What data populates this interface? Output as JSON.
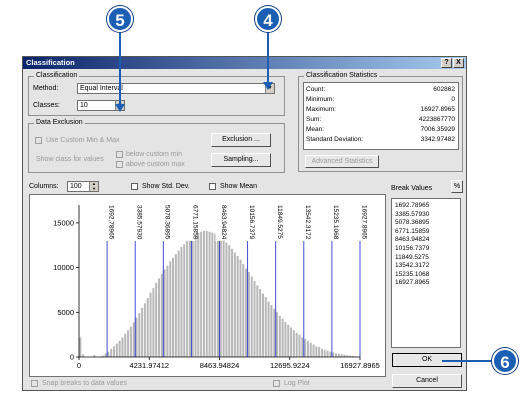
{
  "window": {
    "title": "Classification",
    "help_btn": "?",
    "close_btn": "X"
  },
  "classification": {
    "group_label": "Classification",
    "method_label": "Method:",
    "method_value": "Equal Interval",
    "classes_label": "Classes:",
    "classes_value": "10"
  },
  "data_exclusion": {
    "group_label": "Data Exclusion",
    "use_custom_label": "Use Custom Min & Max",
    "show_class_label": "Show class for values",
    "below_label": "below custom min",
    "above_label": "above custom max",
    "exclusion_btn": "Exclusion ...",
    "sampling_btn": "Sampling..."
  },
  "statistics": {
    "group_label": "Classification Statistics",
    "rows": [
      {
        "key": "Count:",
        "value": "602862"
      },
      {
        "key": "Minimum:",
        "value": "0"
      },
      {
        "key": "Maximum:",
        "value": "16927.8965"
      },
      {
        "key": "Sum:",
        "value": "4223867770"
      },
      {
        "key": "Mean:",
        "value": "7006.35929"
      },
      {
        "key": "Standard Deviation:",
        "value": "3342.97482"
      }
    ],
    "advanced_btn": "Advanced Statistics"
  },
  "controls": {
    "columns_label": "Columns:",
    "columns_value": "100",
    "show_std_dev": "Show Std. Dev.",
    "show_mean": "Show Mean"
  },
  "break_values": {
    "label": "Break Values",
    "percent_btn": "%",
    "values": [
      "1692.78965",
      "3385.57930",
      "5078.36895",
      "6771.15859",
      "8463.94824",
      "10156.7379",
      "11849.5275",
      "13542.3172",
      "15235.1068",
      "16927.8965"
    ]
  },
  "buttons": {
    "ok": "OK",
    "cancel": "Cancel"
  },
  "footer": {
    "snap_label": "Snap breaks to data values",
    "log_label": "Log Plot"
  },
  "callouts": {
    "c5": "5",
    "c4": "4",
    "c6": "6"
  },
  "colors": {
    "break_line": "#2b3bd6",
    "histogram_bar": "#b8b8b8",
    "callout": "#1a5fb4"
  },
  "chart_data": {
    "type": "bar",
    "title": "",
    "xlabel": "",
    "ylabel": "",
    "xlim": [
      0,
      16927.8965
    ],
    "ylim": [
      0,
      17000
    ],
    "y_ticks": [
      0,
      5000,
      10000,
      15000
    ],
    "y_tick_labels": [
      "0",
      "5000",
      "10000",
      "15000"
    ],
    "x_ticks": [
      0,
      4231.97412,
      8463.94824,
      12695.9224,
      16927.8965
    ],
    "x_tick_labels": [
      "0",
      "4231.97412",
      "8463.94824",
      "12695.9224",
      "16927.8965"
    ],
    "break_values": [
      1692.78965,
      3385.5793,
      5078.36895,
      6771.15859,
      8463.94824,
      10156.7379,
      11849.5275,
      13542.3172,
      15235.1068,
      16927.8965
    ],
    "break_labels": [
      "1692.78965",
      "3385.57930",
      "5078.36895",
      "6771.15859",
      "8463.94824",
      "10156.7379",
      "11849.5275",
      "13542.3172",
      "15235.1068",
      "16927.8965"
    ],
    "columns": 100,
    "values": [
      2200,
      300,
      0,
      0,
      0,
      200,
      0,
      0,
      150,
      400,
      600,
      900,
      1200,
      1500,
      1800,
      2200,
      2600,
      3000,
      3400,
      3900,
      4400,
      4900,
      5500,
      6000,
      6600,
      7200,
      7700,
      8300,
      8800,
      9300,
      9800,
      10200,
      10700,
      11100,
      11500,
      11900,
      12300,
      12600,
      13000,
      13300,
      13500,
      13700,
      13900,
      14000,
      14100,
      14100,
      14000,
      13900,
      13800,
      13600,
      13400,
      13100,
      12800,
      12500,
      12100,
      11700,
      11300,
      10900,
      10400,
      9900,
      9500,
      9000,
      8500,
      8000,
      7600,
      7100,
      6700,
      6200,
      5800,
      5400,
      5000,
      4600,
      4300,
      3900,
      3600,
      3300,
      3000,
      2700,
      2500,
      2200,
      2000,
      1800,
      1600,
      1400,
      1200,
      1100,
      900,
      800,
      700,
      600,
      500,
      400,
      350,
      300,
      250,
      200,
      150,
      120,
      80,
      40
    ]
  }
}
